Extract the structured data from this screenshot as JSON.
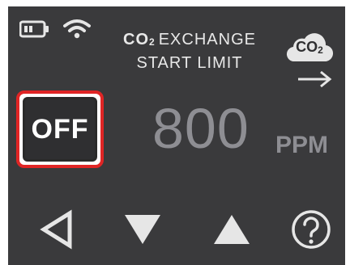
{
  "status": {
    "battery_icon": "battery-icon",
    "wifi_icon": "wifi-icon"
  },
  "title": {
    "line1_prefix": "CO",
    "line1_sub": "2",
    "line1_rest": "EXCHANGE",
    "line2": "START LIMIT"
  },
  "badge": {
    "text": "CO",
    "sub": "2",
    "icon": "cloud-icon",
    "arrow_icon": "arrow-right-icon"
  },
  "toggle": {
    "label": "OFF"
  },
  "reading": {
    "value": "800",
    "unit": "PPM"
  },
  "nav": {
    "back_icon": "back-triangle-icon",
    "down_icon": "down-triangle-icon",
    "up_icon": "up-triangle-icon",
    "help_icon": "help-icon"
  },
  "colors": {
    "screen_bg": "#3a3a3c",
    "accent_red": "#e02525",
    "value_gray": "#8e8e93"
  }
}
